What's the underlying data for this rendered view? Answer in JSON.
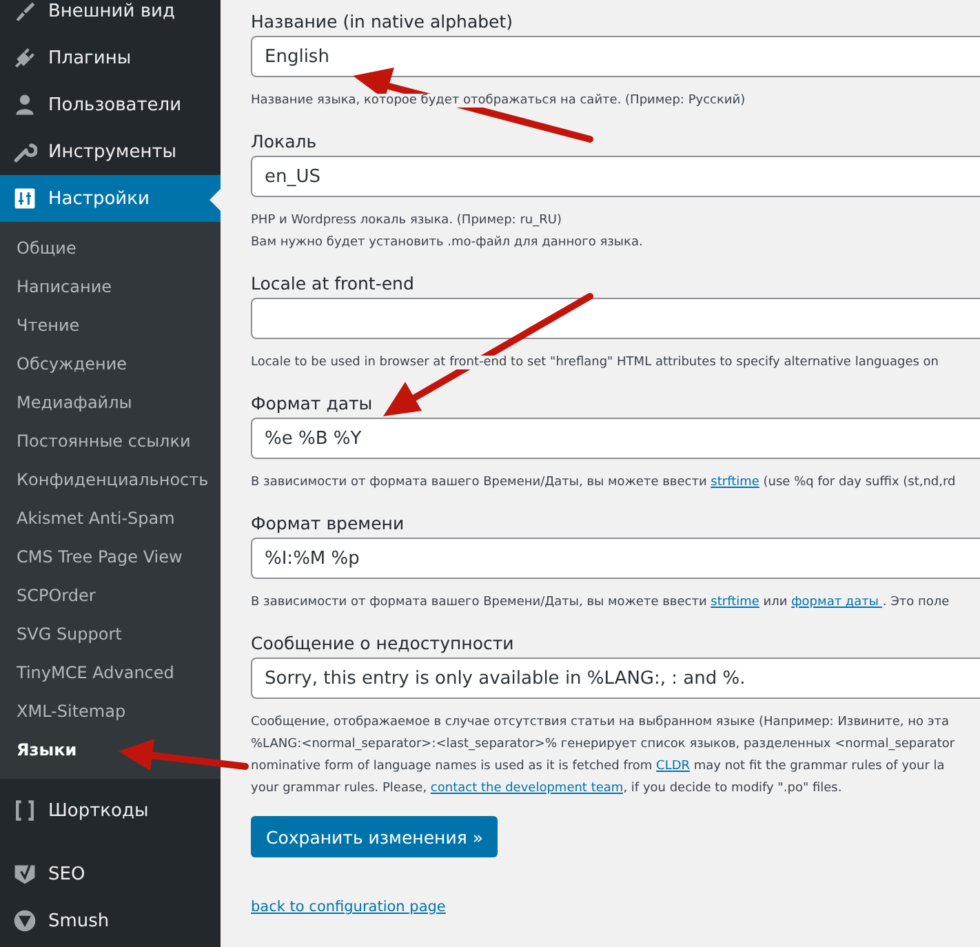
{
  "sidebar": {
    "items": [
      {
        "label": "Внешний вид",
        "selected": false
      },
      {
        "label": "Плагины",
        "selected": false
      },
      {
        "label": "Пользователи",
        "selected": false
      },
      {
        "label": "Инструменты",
        "selected": false
      },
      {
        "label": "Настройки",
        "selected": true,
        "children": [
          {
            "label": "Общие",
            "selected": false
          },
          {
            "label": "Написание",
            "selected": false
          },
          {
            "label": "Чтение",
            "selected": false
          },
          {
            "label": "Обсуждение",
            "selected": false
          },
          {
            "label": "Медиафайлы",
            "selected": false
          },
          {
            "label": "Постоянные ссылки",
            "selected": false
          },
          {
            "label": "Конфиденциальность",
            "selected": false
          },
          {
            "label": "Akismet Anti-Spam",
            "selected": false
          },
          {
            "label": "CMS Tree Page View",
            "selected": false
          },
          {
            "label": "SCPOrder",
            "selected": false
          },
          {
            "label": "SVG Support",
            "selected": false
          },
          {
            "label": "TinyMCE Advanced",
            "selected": false
          },
          {
            "label": "XML-Sitemap",
            "selected": false
          },
          {
            "label": "Языки",
            "selected": true
          }
        ]
      },
      {
        "label": "Шорткоды",
        "selected": false
      },
      {
        "label": "SEO",
        "selected": false
      },
      {
        "label": "Smush",
        "selected": false
      }
    ]
  },
  "form": {
    "fields": [
      {
        "label": "Название (in native alphabet)",
        "value": "English",
        "description": [
          [
            {
              "text": "Название языка, которое будет отображаться на сайте. (Пример: Русский)"
            }
          ]
        ]
      },
      {
        "label": "Локаль",
        "value": "en_US",
        "description": [
          [
            {
              "text": "PHP и Wordpress локаль языка. (Пример: ru_RU)"
            }
          ],
          [
            {
              "text": "Вам нужно будет установить .mo-файл для данного языка."
            }
          ]
        ]
      },
      {
        "label": "Locale at front-end",
        "description": [
          [
            {
              "text": "Locale to be used in browser at front-end to set \"hreflang\" HTML attributes to specify alternative languages on"
            }
          ]
        ]
      },
      {
        "label": "Формат даты",
        "value": "%e %B %Y",
        "description": [
          [
            {
              "text": "В зависимости от формата вашего Времени/Даты, вы можете ввести "
            },
            {
              "text": "strftime",
              "link": true
            },
            {
              "text": " (use %q for day suffix (st,nd,rd"
            }
          ]
        ]
      },
      {
        "label": "Формат времени",
        "value": "%I:%M %p",
        "description": [
          [
            {
              "text": "В зависимости от формата вашего Времени/Даты, вы можете ввести "
            },
            {
              "text": "strftime",
              "link": true
            },
            {
              "text": " или "
            },
            {
              "text": "формат даты ",
              "link": true
            },
            {
              "text": ". Это поле"
            }
          ]
        ]
      },
      {
        "label": "Сообщение о недоступности",
        "value": "Sorry, this entry is only available in %LANG:, : and %.",
        "description": [
          [
            {
              "text": "Сообщение, отображаемое в случае отсутствия статьи на выбранном языке (Например: Извините, но эта"
            }
          ],
          [
            {
              "text": "%LANG:<normal_separator>:<last_separator>% генерирует список языков, разделенных <normal_separator"
            }
          ],
          [
            {
              "text": "nominative form of language names is used as it is fetched from "
            },
            {
              "text": "CLDR",
              "link": true
            },
            {
              "text": " may not fit the grammar rules of your la"
            }
          ],
          [
            {
              "text": "your grammar rules. Please, "
            },
            {
              "text": "contact the development team",
              "link": true
            },
            {
              "text": ", if you decide to modify \".po\" files."
            }
          ]
        ]
      }
    ],
    "submit": "Сохранить изменения »",
    "back_link": "back to configuration page"
  }
}
